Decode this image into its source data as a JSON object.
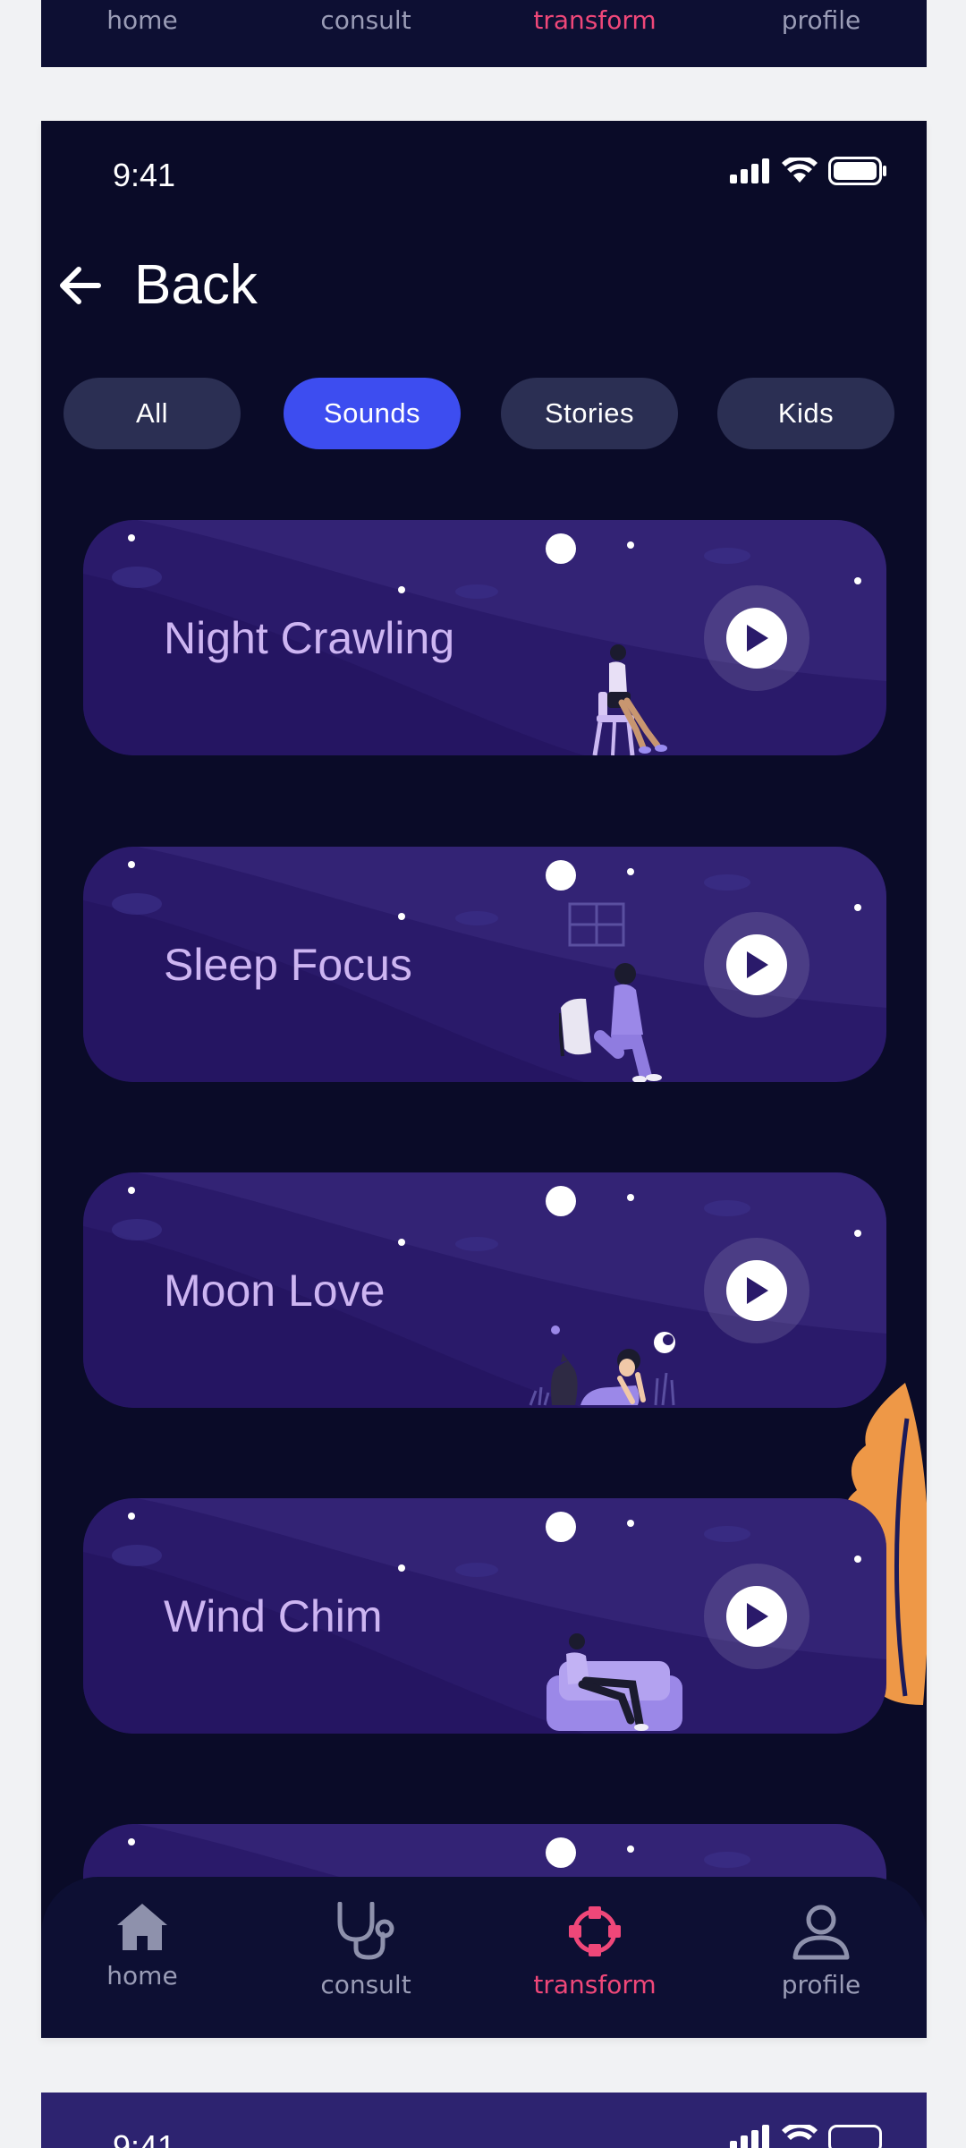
{
  "previous_screen": {
    "nav": [
      "home",
      "consult",
      "transform",
      "profile"
    ]
  },
  "status_bar": {
    "time": "9:41"
  },
  "header": {
    "back_label": "Back"
  },
  "filters": {
    "items": [
      "All",
      "Sounds",
      "Stories",
      "Kids"
    ],
    "selected": "Sounds"
  },
  "tracks": [
    {
      "title": "Night Crawling",
      "illustration": "woman-on-chair"
    },
    {
      "title": "Sleep Focus",
      "illustration": "woman-sitting-on-bed"
    },
    {
      "title": "Moon Love",
      "illustration": "woman-lying-with-cat"
    },
    {
      "title": "Wind Chim",
      "illustration": "man-on-sofa"
    }
  ],
  "bottom_nav": {
    "items": [
      {
        "label": "home",
        "icon": "home-icon"
      },
      {
        "label": "consult",
        "icon": "stethoscope-icon"
      },
      {
        "label": "transform",
        "icon": "transform-icon"
      },
      {
        "label": "profile",
        "icon": "profile-icon"
      }
    ],
    "active": "transform"
  },
  "next_screen": {
    "time": "9:41"
  },
  "colors": {
    "background": "#0a0b28",
    "card": "#2a1a6a",
    "card_title": "#cdb5f2",
    "pill": "#2b2f53",
    "pill_active": "#3d4df0",
    "nav_active": "#ef4779",
    "nav_inactive": "#9a9cb6"
  }
}
